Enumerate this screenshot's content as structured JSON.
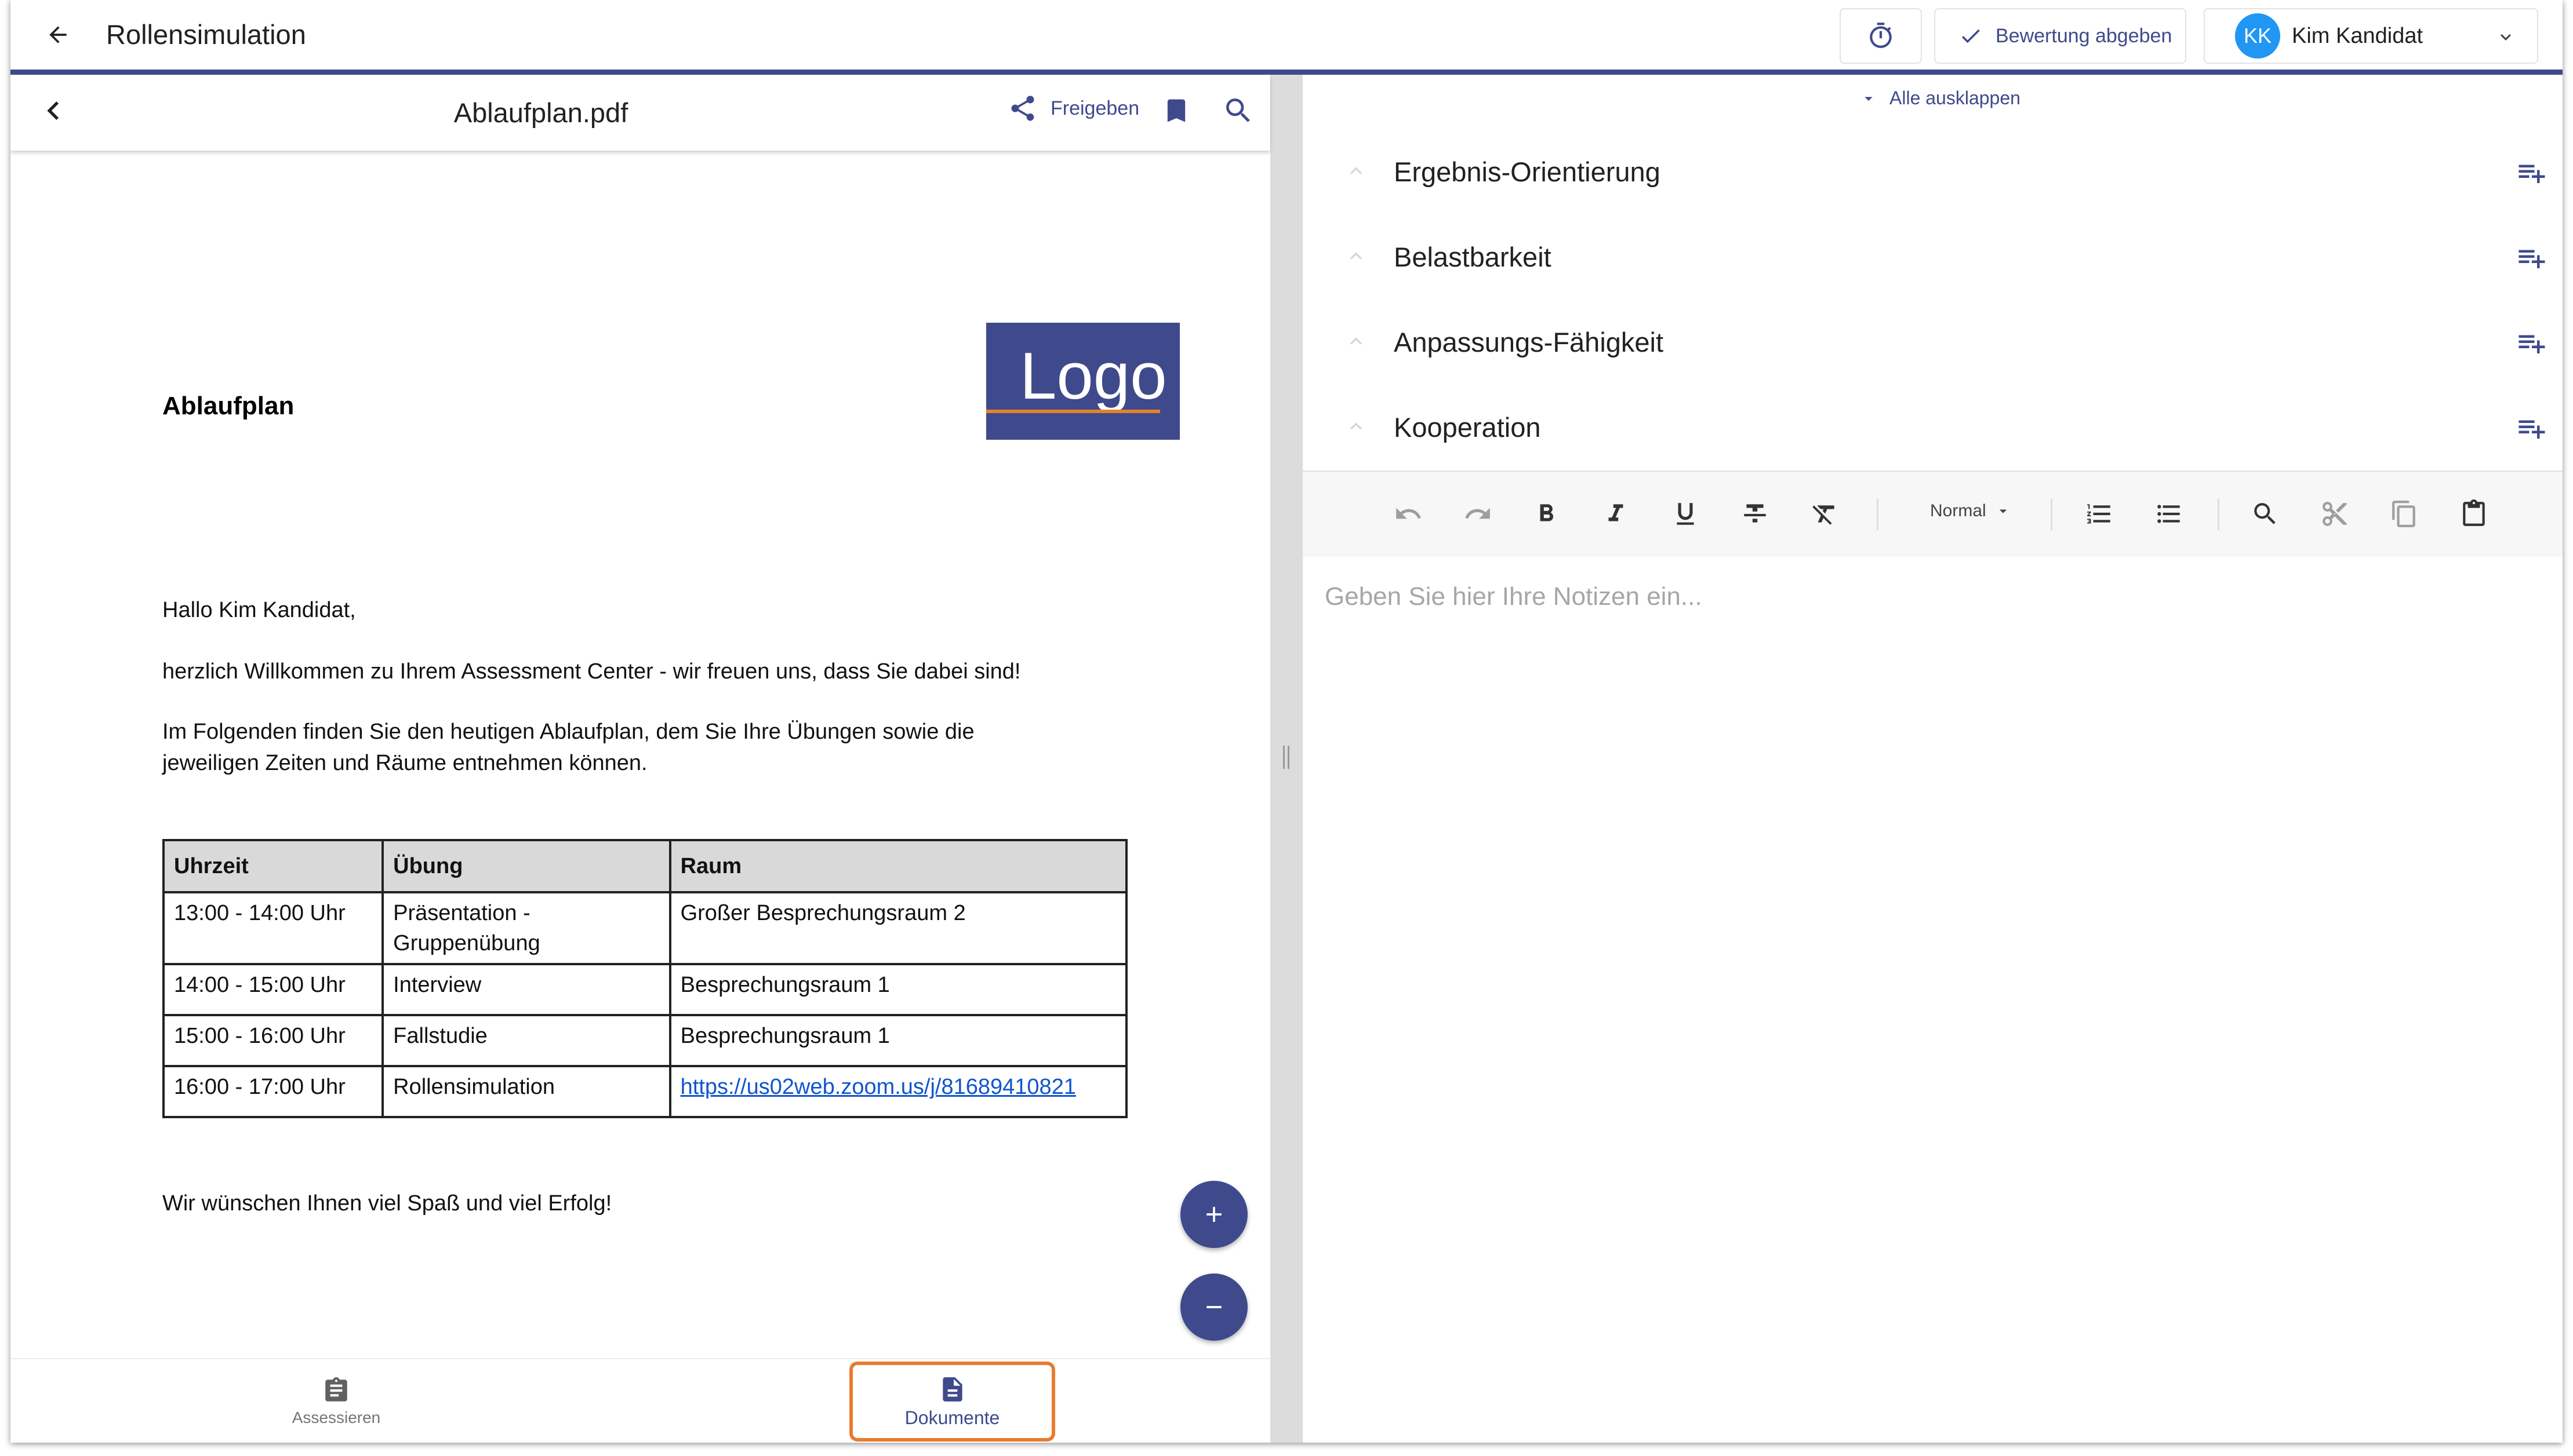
{
  "header": {
    "title": "Rollensimulation",
    "submit_label": "Bewertung abgeben",
    "user_initials": "KK",
    "user_name": "Kim Kandidat",
    "accent_color": "#3f4a8c",
    "avatar_color": "#2196f3"
  },
  "viewer": {
    "file_name": "Ablaufplan.pdf",
    "share_label": "Freigeben",
    "zoom_in_label": "+",
    "zoom_out_label": "−"
  },
  "document": {
    "logo_text": "Logo",
    "heading": "Ablaufplan",
    "greeting": "Hallo Kim Kandidat,",
    "welcome": "herzlich Willkommen zu Ihrem Assessment Center - wir freuen uns, dass Sie dabei sind!",
    "intro_line1": "Im Folgenden finden Sie den heutigen Ablaufplan, dem Sie Ihre Übungen sowie die",
    "intro_line2": "jeweiligen Zeiten und Räume entnehmen können.",
    "table": {
      "headers": [
        "Uhrzeit",
        "Übung",
        "Raum"
      ],
      "rows": [
        [
          "13:00 - 14:00 Uhr",
          "Präsentation -",
          "Gruppenübung",
          "Großer Besprechungsraum 2"
        ],
        [
          "14:00 - 15:00 Uhr",
          "Interview",
          "Besprechungsraum 1"
        ],
        [
          "15:00 - 16:00 Uhr",
          "Fallstudie",
          "Besprechungsraum 1"
        ],
        [
          "16:00 - 17:00 Uhr",
          "Rollensimulation",
          "https://us02web.zoom.us/j/81689410821"
        ]
      ]
    },
    "closing": "Wir wünschen Ihnen viel Spaß und viel Erfolg!"
  },
  "bottom_nav": {
    "items": [
      {
        "label": "Assessieren",
        "icon": "clipboard-icon"
      },
      {
        "label": "Dokumente",
        "icon": "document-icon"
      }
    ],
    "active_highlight_color": "#e97a2e"
  },
  "criteria": {
    "expand_all_label": "Alle ausklappen",
    "items": [
      {
        "label": "Ergebnis-Orientierung"
      },
      {
        "label": "Belastbarkeit"
      },
      {
        "label": "Anpassungs-Fähigkeit"
      },
      {
        "label": "Kooperation"
      }
    ]
  },
  "editor": {
    "format_label": "Normal",
    "placeholder": "Geben Sie hier Ihre Notizen ein..."
  }
}
